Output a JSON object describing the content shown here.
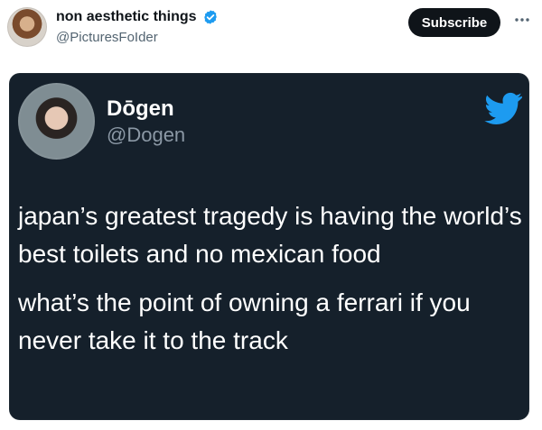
{
  "header": {
    "account_name": "non aesthetic things",
    "account_handle": "@PicturesFoIder",
    "subscribe_label": "Subscribe",
    "more_label": "···"
  },
  "tweet": {
    "author_name": "Dōgen",
    "author_handle": "@Dogen",
    "text_paragraphs": [
      "japan’s greatest tragedy is having the world’s best toilets and no mexican food",
      "what’s the point of owning a ferrari if you never take it to the track"
    ]
  },
  "icons": {
    "verified": "verified-icon",
    "more": "more-icon",
    "bird": "twitter-bird-icon"
  }
}
